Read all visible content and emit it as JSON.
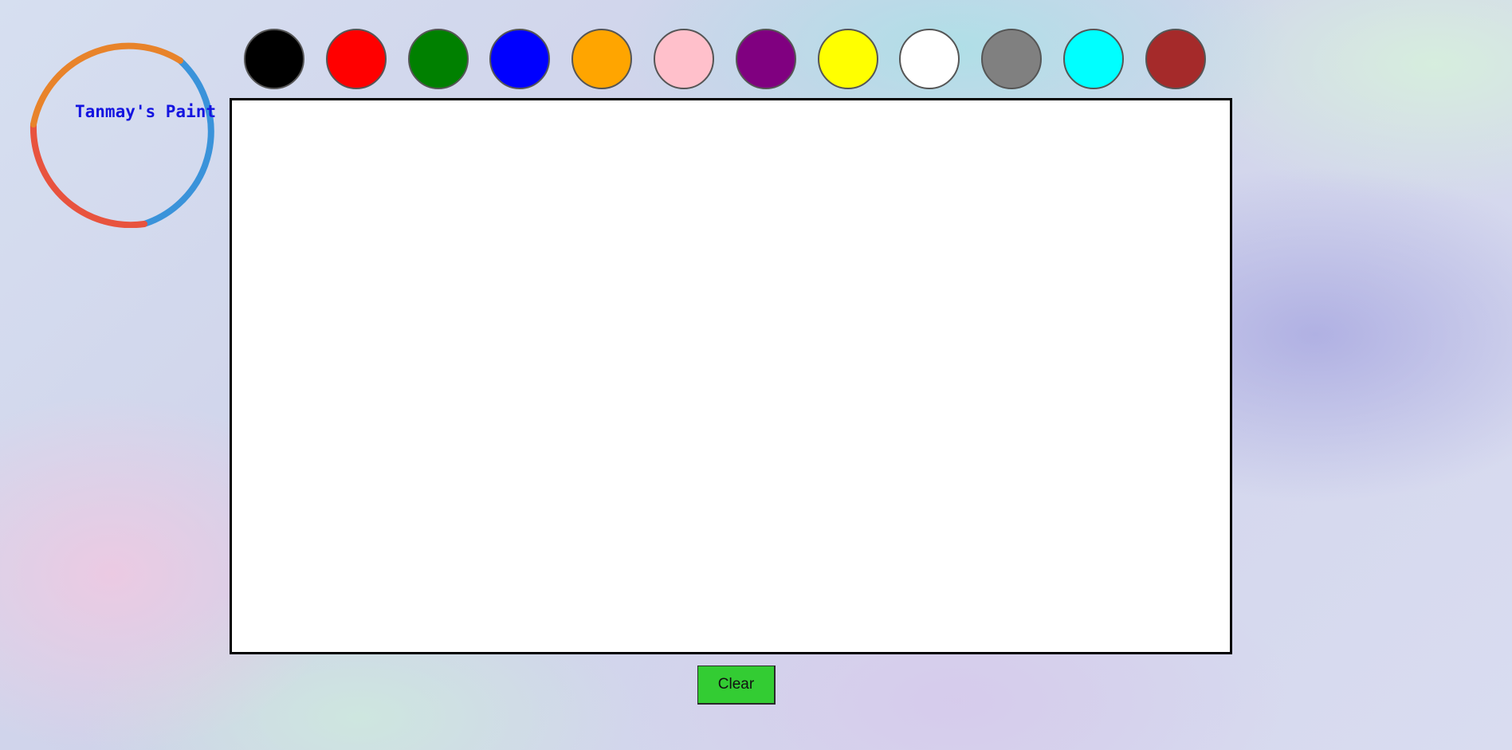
{
  "logo": {
    "text": "Tanmay's Paint",
    "ring_colors": [
      "#e8832a",
      "#e8533e",
      "#3a93da"
    ]
  },
  "palette": {
    "colors": [
      {
        "name": "black",
        "hex": "#000000"
      },
      {
        "name": "red",
        "hex": "#ff0000"
      },
      {
        "name": "green",
        "hex": "#008000"
      },
      {
        "name": "blue",
        "hex": "#0000ff"
      },
      {
        "name": "orange",
        "hex": "#ffa500"
      },
      {
        "name": "pink",
        "hex": "#ffc0cb"
      },
      {
        "name": "purple",
        "hex": "#800080"
      },
      {
        "name": "yellow",
        "hex": "#ffff00"
      },
      {
        "name": "white",
        "hex": "#ffffff"
      },
      {
        "name": "gray",
        "hex": "#808080"
      },
      {
        "name": "cyan",
        "hex": "#00ffff"
      },
      {
        "name": "brown",
        "hex": "#a52a2a"
      }
    ]
  },
  "canvas": {
    "background": "#ffffff"
  },
  "controls": {
    "clear_label": "Clear",
    "clear_color": "#33cc33"
  }
}
